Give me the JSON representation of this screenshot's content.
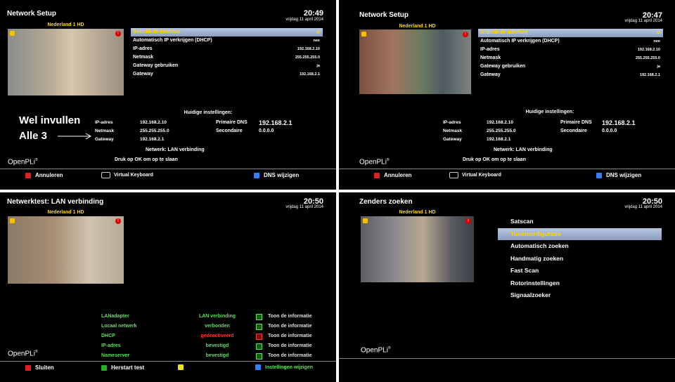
{
  "panels": {
    "p1": {
      "title": "Network Setup",
      "time": "20:49",
      "date": "vrijdag 11 april 2014",
      "channel": "Nederland 1 HD",
      "menu": [
        {
          "label": "Gebruik de interface",
          "value": "ja"
        },
        {
          "label": "Automatisch IP verkrijgen (DHCP)",
          "value": "nee"
        },
        {
          "label": "IP-adres",
          "value": "192.168.2.10"
        },
        {
          "label": "Netmask",
          "value": "255.255.255.0"
        },
        {
          "label": "Gateway gebruiken",
          "value": "ja"
        },
        {
          "label": "Gateway",
          "value": "192.168.2.1"
        }
      ],
      "current_heading": "Huidige instellingen:",
      "current": [
        {
          "label": "IP-adres",
          "value": "192.168.2.10"
        },
        {
          "label": "Netmask",
          "value": "255.255.255.0"
        },
        {
          "label": "Gateway",
          "value": "192.168.2.1"
        }
      ],
      "primary_dns_label": "Primaire DNS",
      "primary_dns_value": "192.168.2.1",
      "secondary_dns_label": "Secondaire",
      "secondary_dns_value": "0.0.0.0",
      "network_label": "Netwerk:",
      "network_value": "LAN verbinding",
      "ok_hint": "Druk op OK om op te slaan",
      "logo": "OpenPLi",
      "annotation_line1": "Wel invullen",
      "annotation_line2": "Alle 3",
      "footer": {
        "red": "Annuleren",
        "keyboard": "Virtual Keyboard",
        "blue": "DNS wijzigen"
      }
    },
    "p2": {
      "title": "Network Setup",
      "time": "20:47",
      "date": "vrijdag 11 april 2014",
      "channel": "Nederland 1 HD",
      "menu": [
        {
          "label": "Gebruik de interface",
          "value": "ja"
        },
        {
          "label": "Automatisch IP verkrijgen (DHCP)",
          "value": "nee"
        },
        {
          "label": "IP-adres",
          "value": "192.168.2.10"
        },
        {
          "label": "Netmask",
          "value": "255.255.255.0"
        },
        {
          "label": "Gateway gebruiken",
          "value": "ja"
        },
        {
          "label": "Gateway",
          "value": "192.168.2.1"
        }
      ],
      "current_heading": "Huidige instellingen:",
      "current": [
        {
          "label": "IP-adres",
          "value": "192.168.2.10"
        },
        {
          "label": "Netmask",
          "value": "255.255.255.0"
        },
        {
          "label": "Gateway",
          "value": "192.168.2.1"
        }
      ],
      "primary_dns_label": "Primaire DNS",
      "primary_dns_value": "192.168.2.1",
      "secondary_dns_label": "Secondaire",
      "secondary_dns_value": "0.0.0.0",
      "network_label": "Netwerk:",
      "network_value": "LAN verbinding",
      "ok_hint": "Druk op OK om op te slaan",
      "logo": "OpenPLi",
      "footer": {
        "red": "Annuleren",
        "keyboard": "Virtual Keyboard",
        "blue": "DNS wijzigen"
      }
    },
    "p3": {
      "title": "Netwerktest: LAN verbinding",
      "time": "20:50",
      "date": "vrijdag 11 april 2014",
      "channel": "Nederland 1 HD",
      "rows": [
        {
          "name": "LANadapter",
          "status": "LAN verbinding",
          "info": "Toon de informatie",
          "error": false
        },
        {
          "name": "Locaal netwerk",
          "status": "verbonden",
          "info": "Toon de informatie",
          "error": false
        },
        {
          "name": "DHCP",
          "status": "gedeactiveerd",
          "info": "Toon de informatie",
          "error": true
        },
        {
          "name": "IP-adres",
          "status": "bevestigd",
          "info": "Toon de informatie",
          "error": false
        },
        {
          "name": "Nameserver",
          "status": "bevestigd",
          "info": "Toon de informatie",
          "error": false
        }
      ],
      "logo": "OpenPLi",
      "footer": {
        "red": "Sluiten",
        "green": "Herstart test",
        "blue": "Instellingen wijzigen"
      }
    },
    "p4": {
      "title": "Zenders zoeken",
      "time": "20:50",
      "date": "vrijdag 11 april 2014",
      "channel": "Nederland 1 HD",
      "items": [
        "Satscan",
        "Tunerconfiguratie",
        "Automatisch zoeken",
        "Handmatig zoeken",
        "Fast Scan",
        "Rotorinstellingen",
        "Signaalzoeker"
      ],
      "selected_index": 1,
      "logo": "OpenPLi"
    }
  },
  "colors": {
    "selection": "#9aabcf",
    "highlight_text": "#ffd800",
    "test_ok": "#5fe15f",
    "test_error": "#ff3333"
  }
}
